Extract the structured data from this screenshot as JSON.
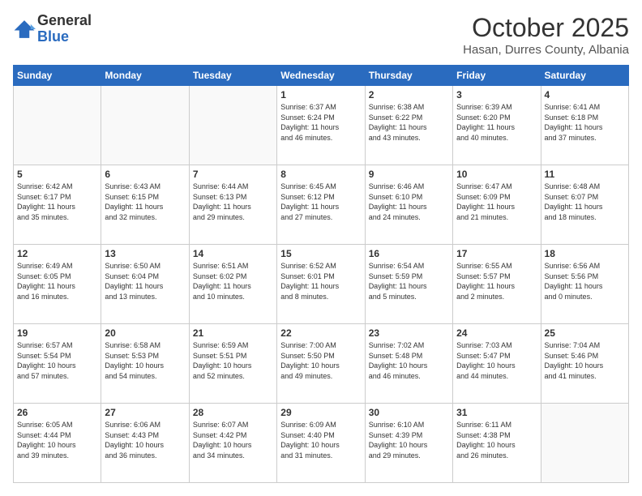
{
  "logo": {
    "general": "General",
    "blue": "Blue"
  },
  "header": {
    "month": "October 2025",
    "location": "Hasan, Durres County, Albania"
  },
  "weekdays": [
    "Sunday",
    "Monday",
    "Tuesday",
    "Wednesday",
    "Thursday",
    "Friday",
    "Saturday"
  ],
  "weeks": [
    [
      {
        "day": "",
        "info": ""
      },
      {
        "day": "",
        "info": ""
      },
      {
        "day": "",
        "info": ""
      },
      {
        "day": "1",
        "info": "Sunrise: 6:37 AM\nSunset: 6:24 PM\nDaylight: 11 hours\nand 46 minutes."
      },
      {
        "day": "2",
        "info": "Sunrise: 6:38 AM\nSunset: 6:22 PM\nDaylight: 11 hours\nand 43 minutes."
      },
      {
        "day": "3",
        "info": "Sunrise: 6:39 AM\nSunset: 6:20 PM\nDaylight: 11 hours\nand 40 minutes."
      },
      {
        "day": "4",
        "info": "Sunrise: 6:41 AM\nSunset: 6:18 PM\nDaylight: 11 hours\nand 37 minutes."
      }
    ],
    [
      {
        "day": "5",
        "info": "Sunrise: 6:42 AM\nSunset: 6:17 PM\nDaylight: 11 hours\nand 35 minutes."
      },
      {
        "day": "6",
        "info": "Sunrise: 6:43 AM\nSunset: 6:15 PM\nDaylight: 11 hours\nand 32 minutes."
      },
      {
        "day": "7",
        "info": "Sunrise: 6:44 AM\nSunset: 6:13 PM\nDaylight: 11 hours\nand 29 minutes."
      },
      {
        "day": "8",
        "info": "Sunrise: 6:45 AM\nSunset: 6:12 PM\nDaylight: 11 hours\nand 27 minutes."
      },
      {
        "day": "9",
        "info": "Sunrise: 6:46 AM\nSunset: 6:10 PM\nDaylight: 11 hours\nand 24 minutes."
      },
      {
        "day": "10",
        "info": "Sunrise: 6:47 AM\nSunset: 6:09 PM\nDaylight: 11 hours\nand 21 minutes."
      },
      {
        "day": "11",
        "info": "Sunrise: 6:48 AM\nSunset: 6:07 PM\nDaylight: 11 hours\nand 18 minutes."
      }
    ],
    [
      {
        "day": "12",
        "info": "Sunrise: 6:49 AM\nSunset: 6:05 PM\nDaylight: 11 hours\nand 16 minutes."
      },
      {
        "day": "13",
        "info": "Sunrise: 6:50 AM\nSunset: 6:04 PM\nDaylight: 11 hours\nand 13 minutes."
      },
      {
        "day": "14",
        "info": "Sunrise: 6:51 AM\nSunset: 6:02 PM\nDaylight: 11 hours\nand 10 minutes."
      },
      {
        "day": "15",
        "info": "Sunrise: 6:52 AM\nSunset: 6:01 PM\nDaylight: 11 hours\nand 8 minutes."
      },
      {
        "day": "16",
        "info": "Sunrise: 6:54 AM\nSunset: 5:59 PM\nDaylight: 11 hours\nand 5 minutes."
      },
      {
        "day": "17",
        "info": "Sunrise: 6:55 AM\nSunset: 5:57 PM\nDaylight: 11 hours\nand 2 minutes."
      },
      {
        "day": "18",
        "info": "Sunrise: 6:56 AM\nSunset: 5:56 PM\nDaylight: 11 hours\nand 0 minutes."
      }
    ],
    [
      {
        "day": "19",
        "info": "Sunrise: 6:57 AM\nSunset: 5:54 PM\nDaylight: 10 hours\nand 57 minutes."
      },
      {
        "day": "20",
        "info": "Sunrise: 6:58 AM\nSunset: 5:53 PM\nDaylight: 10 hours\nand 54 minutes."
      },
      {
        "day": "21",
        "info": "Sunrise: 6:59 AM\nSunset: 5:51 PM\nDaylight: 10 hours\nand 52 minutes."
      },
      {
        "day": "22",
        "info": "Sunrise: 7:00 AM\nSunset: 5:50 PM\nDaylight: 10 hours\nand 49 minutes."
      },
      {
        "day": "23",
        "info": "Sunrise: 7:02 AM\nSunset: 5:48 PM\nDaylight: 10 hours\nand 46 minutes."
      },
      {
        "day": "24",
        "info": "Sunrise: 7:03 AM\nSunset: 5:47 PM\nDaylight: 10 hours\nand 44 minutes."
      },
      {
        "day": "25",
        "info": "Sunrise: 7:04 AM\nSunset: 5:46 PM\nDaylight: 10 hours\nand 41 minutes."
      }
    ],
    [
      {
        "day": "26",
        "info": "Sunrise: 6:05 AM\nSunset: 4:44 PM\nDaylight: 10 hours\nand 39 minutes."
      },
      {
        "day": "27",
        "info": "Sunrise: 6:06 AM\nSunset: 4:43 PM\nDaylight: 10 hours\nand 36 minutes."
      },
      {
        "day": "28",
        "info": "Sunrise: 6:07 AM\nSunset: 4:42 PM\nDaylight: 10 hours\nand 34 minutes."
      },
      {
        "day": "29",
        "info": "Sunrise: 6:09 AM\nSunset: 4:40 PM\nDaylight: 10 hours\nand 31 minutes."
      },
      {
        "day": "30",
        "info": "Sunrise: 6:10 AM\nSunset: 4:39 PM\nDaylight: 10 hours\nand 29 minutes."
      },
      {
        "day": "31",
        "info": "Sunrise: 6:11 AM\nSunset: 4:38 PM\nDaylight: 10 hours\nand 26 minutes."
      },
      {
        "day": "",
        "info": ""
      }
    ]
  ]
}
